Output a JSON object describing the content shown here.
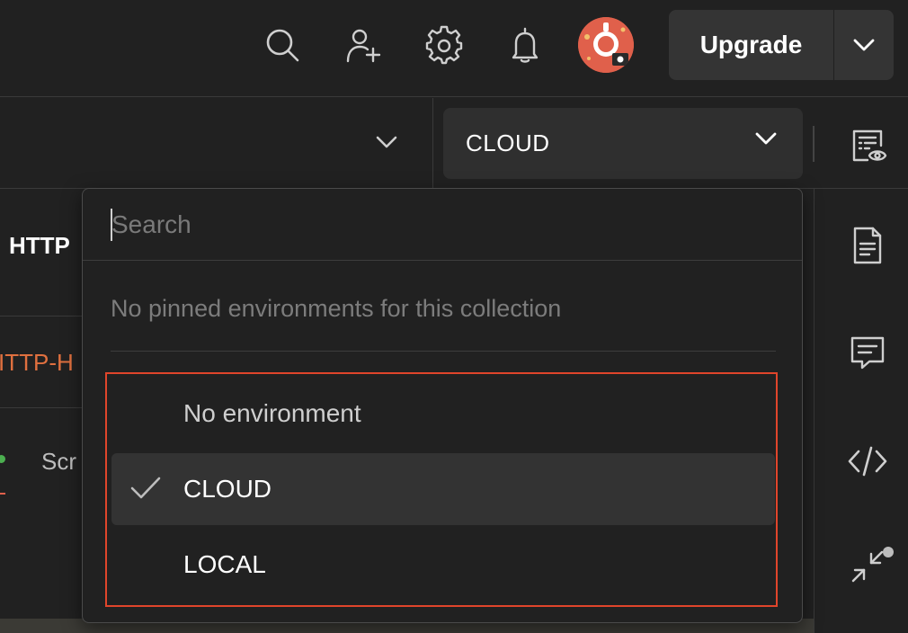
{
  "header": {
    "upgrade_label": "Upgrade",
    "icons": [
      "search-icon",
      "invite-user-icon",
      "settings-icon",
      "notifications-icon"
    ]
  },
  "environment_selector": {
    "selected_label": "CLOUD"
  },
  "left_panel": {
    "title_fragment": "HTTP",
    "tab_fragment": "ITTP-H",
    "row_fragment": "Scr"
  },
  "dropdown": {
    "search_placeholder": "Search",
    "pinned_message": "No pinned environments for this collection",
    "options": [
      {
        "label": "No environment",
        "selected": false
      },
      {
        "label": "CLOUD",
        "selected": true
      },
      {
        "label": "LOCAL",
        "selected": false
      }
    ]
  },
  "colors": {
    "background": "#212121",
    "accent_orange": "#e0604b",
    "highlight_border": "#e0452b",
    "status_green": "#4caf50",
    "muted_text": "#7c7c7c"
  }
}
